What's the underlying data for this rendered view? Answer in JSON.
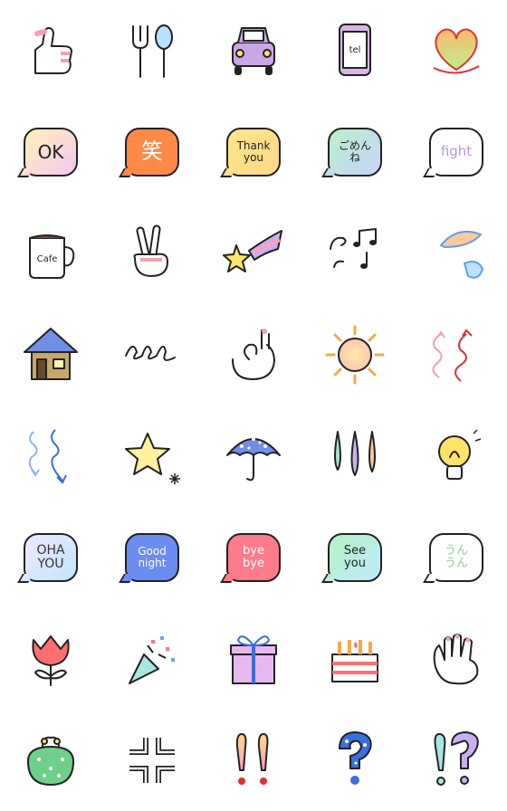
{
  "stickers": [
    {
      "name": "thumbs-up",
      "icon": "thumbs-up-icon"
    },
    {
      "name": "fork-spoon",
      "icon": "fork-spoon-icon"
    },
    {
      "name": "car",
      "icon": "car-icon",
      "color": "#c9a7e6"
    },
    {
      "name": "phone-tel",
      "icon": "phone-icon",
      "label": "tel",
      "color": "#d8b4e8"
    },
    {
      "name": "heart",
      "icon": "heart-icon",
      "color": "#f5d24a"
    },
    {
      "name": "bubble-ok",
      "text": "OK",
      "bg": [
        "#fff3b8",
        "#f4c6ef"
      ],
      "fg": "#222",
      "size": 20
    },
    {
      "name": "bubble-laugh",
      "text": "笑",
      "bg": [
        "#ff8a47",
        "#ff8a47"
      ],
      "fg": "#fff",
      "size": 24
    },
    {
      "name": "bubble-thank-you",
      "text": "Thank\nyou",
      "bg": [
        "#ffe58a",
        "#ffd98a"
      ],
      "fg": "#222",
      "size": 12
    },
    {
      "name": "bubble-gomenne",
      "text": "ごめん\nね",
      "bg": [
        "#b9f0c8",
        "#c8d2ff"
      ],
      "fg": "#222",
      "size": 12
    },
    {
      "name": "bubble-fight",
      "text": "fight",
      "bg": [
        "#ffffff",
        "#ffffff"
      ],
      "fg": "#b99ad8",
      "size": 15
    },
    {
      "name": "coffee-cup",
      "icon": "cup-icon",
      "label": "Cafe"
    },
    {
      "name": "peace-hand",
      "icon": "peace-icon"
    },
    {
      "name": "shooting-star",
      "icon": "shooting-star-icon"
    },
    {
      "name": "music-notes",
      "icon": "music-icon"
    },
    {
      "name": "sweat-drops",
      "icon": "sweat-icon"
    },
    {
      "name": "house",
      "icon": "house-icon"
    },
    {
      "name": "loops",
      "icon": "loops-icon"
    },
    {
      "name": "ok-hand",
      "icon": "ok-hand-icon"
    },
    {
      "name": "sun",
      "icon": "sun-icon"
    },
    {
      "name": "up-arrows",
      "icon": "up-arrows-icon"
    },
    {
      "name": "down-arrows",
      "icon": "down-arrows-icon"
    },
    {
      "name": "star-sparkle",
      "icon": "star-icon"
    },
    {
      "name": "umbrella",
      "icon": "umbrella-icon"
    },
    {
      "name": "rain-drops",
      "icon": "drops-icon"
    },
    {
      "name": "light-bulb",
      "icon": "bulb-icon"
    },
    {
      "name": "bubble-ohayou",
      "text": "OHA\nYOU",
      "bg": [
        "#f0e8ff",
        "#bfe7ff"
      ],
      "fg": "#333",
      "size": 14
    },
    {
      "name": "bubble-good-night",
      "text": "Good\nnight",
      "bg": [
        "#6b8cf0",
        "#6b8cf0"
      ],
      "fg": "#fff",
      "size": 12
    },
    {
      "name": "bubble-bye-bye",
      "text": "bye\nbye",
      "bg": [
        "#ff7a8a",
        "#ff7a8a"
      ],
      "fg": "#fff",
      "size": 13
    },
    {
      "name": "bubble-see-you",
      "text": "See\nyou",
      "bg": [
        "#b6f2c2",
        "#bfe9ff"
      ],
      "fg": "#222",
      "size": 13
    },
    {
      "name": "bubble-unun",
      "text": "うん\nうん",
      "bg": [
        "#ffffff",
        "#ffffff"
      ],
      "fg": "#8fc9a0",
      "size": 13
    },
    {
      "name": "tulip",
      "icon": "tulip-icon"
    },
    {
      "name": "party-popper",
      "icon": "popper-icon"
    },
    {
      "name": "gift-box",
      "icon": "gift-icon"
    },
    {
      "name": "birthday-cake",
      "icon": "cake-icon"
    },
    {
      "name": "open-hand",
      "icon": "hand-icon"
    },
    {
      "name": "coin-purse",
      "icon": "purse-icon"
    },
    {
      "name": "anger-mark",
      "icon": "anger-icon"
    },
    {
      "name": "double-exclamation",
      "icon": "exclaim-icon"
    },
    {
      "name": "question-mark",
      "icon": "question-icon"
    },
    {
      "name": "exclaim-question",
      "icon": "exclaim-question-icon"
    }
  ]
}
